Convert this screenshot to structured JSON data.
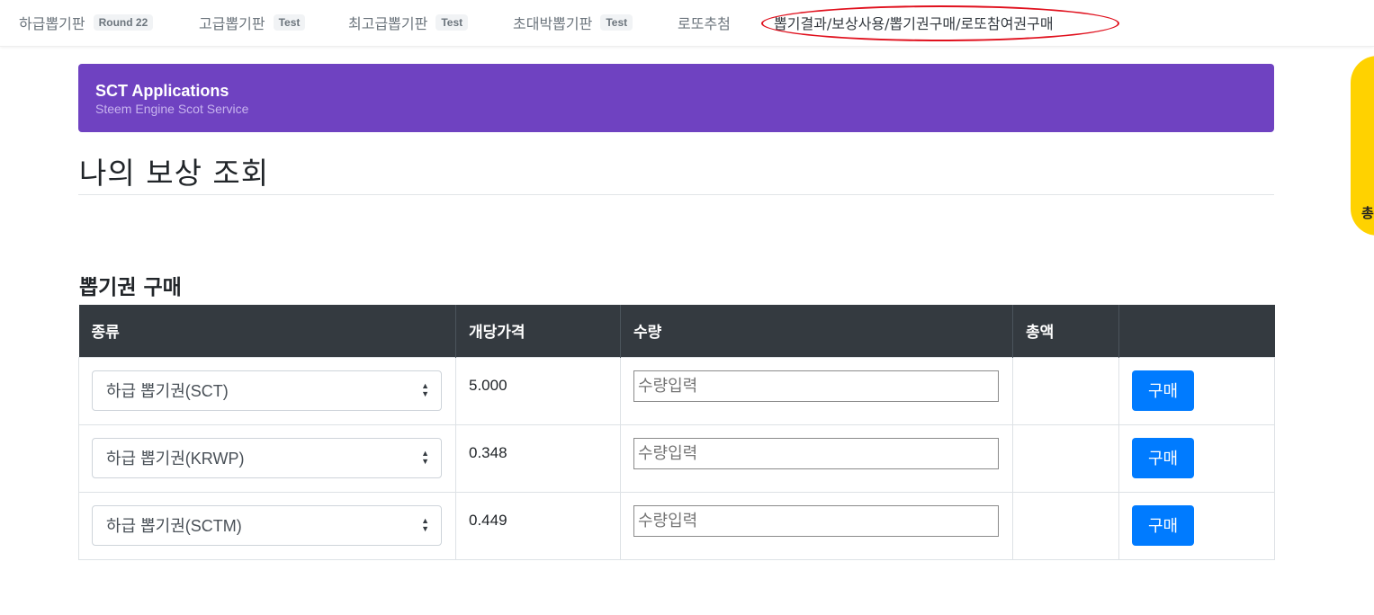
{
  "nav": {
    "items": [
      {
        "label": "하급뽑기판",
        "badge": "Round 22"
      },
      {
        "label": "고급뽑기판",
        "badge": "Test"
      },
      {
        "label": "최고급뽑기판",
        "badge": "Test"
      },
      {
        "label": "초대박뽑기판",
        "badge": "Test"
      },
      {
        "label": "로또추첨",
        "badge": ""
      },
      {
        "label": "뽑기결과/보상사용/뽑기권구매/로또참여권구매",
        "badge": ""
      }
    ],
    "highlight_color": "#e0101d"
  },
  "side_tab": {
    "label": "총",
    "color": "#ffd200"
  },
  "header": {
    "title": "SCT Applications",
    "subtitle": "Steem Engine Scot Service",
    "color": "#6f42c1"
  },
  "page_title": "나의 보상 조회",
  "section_title": "뽑기권 구매",
  "table": {
    "columns": [
      "종류",
      "개당가격",
      "수량",
      "총액",
      ""
    ],
    "rows": [
      {
        "type": "하급 뽑기권(SCT)",
        "price": "5.000",
        "qty_placeholder": "수량입력",
        "total": "",
        "button": "구매"
      },
      {
        "type": "하급 뽑기권(KRWP)",
        "price": "0.348",
        "qty_placeholder": "수량입력",
        "total": "",
        "button": "구매"
      },
      {
        "type": "하급 뽑기권(SCTM)",
        "price": "0.449",
        "qty_placeholder": "수량입력",
        "total": "",
        "button": "구매"
      }
    ]
  },
  "colors": {
    "table_header_bg": "#343a40",
    "button_primary": "#007bff"
  }
}
